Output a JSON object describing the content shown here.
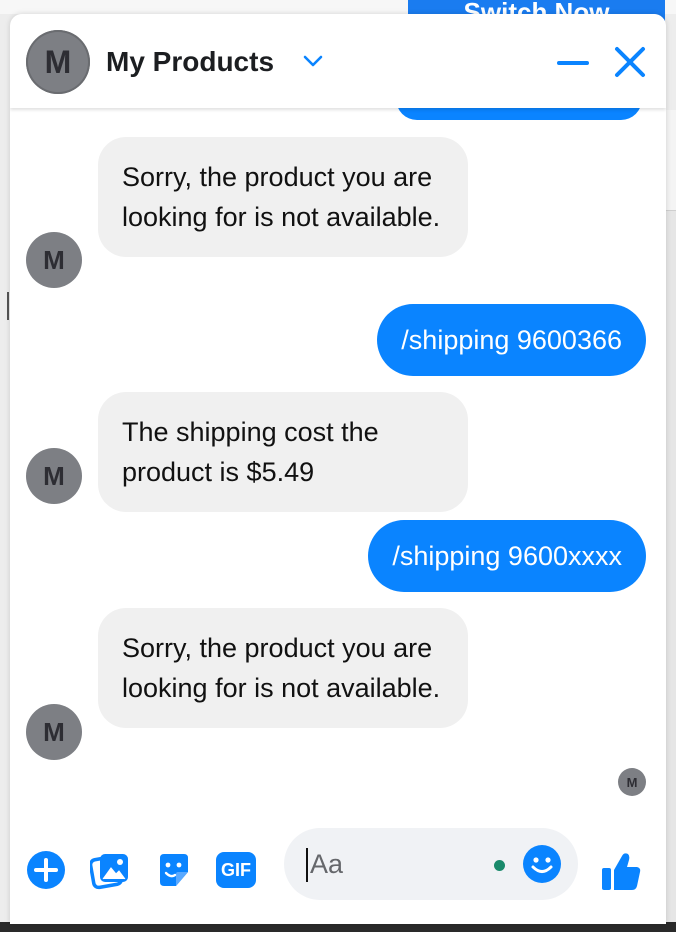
{
  "background": {
    "switch_button_label": "Switch Now"
  },
  "header": {
    "avatar_initial": "M",
    "title": "My Products"
  },
  "messages": [
    {
      "from": "bot",
      "text": "Sorry, the product you are looking for is not available.",
      "avatar_initial": "M"
    },
    {
      "from": "user",
      "text": "/shipping 9600366"
    },
    {
      "from": "bot",
      "text": "The shipping cost the product is $5.49",
      "avatar_initial": "M"
    },
    {
      "from": "user",
      "text": "/shipping 9600xxxx"
    },
    {
      "from": "bot",
      "text": "Sorry, the product you are looking for is not available.",
      "avatar_initial": "M"
    }
  ],
  "seen_avatar_initial": "M",
  "composer": {
    "placeholder": "Aa",
    "gif_label": "GIF",
    "tools": [
      "plus-icon",
      "photo-icon",
      "sticker-icon",
      "gif-icon"
    ],
    "emoji_icon": "smile-icon",
    "send_icon": "thumbs-up-icon"
  },
  "colors": {
    "accent": "#0a84ff",
    "incoming_bubble": "#f0f0f0",
    "avatar": "#7d7f84"
  }
}
